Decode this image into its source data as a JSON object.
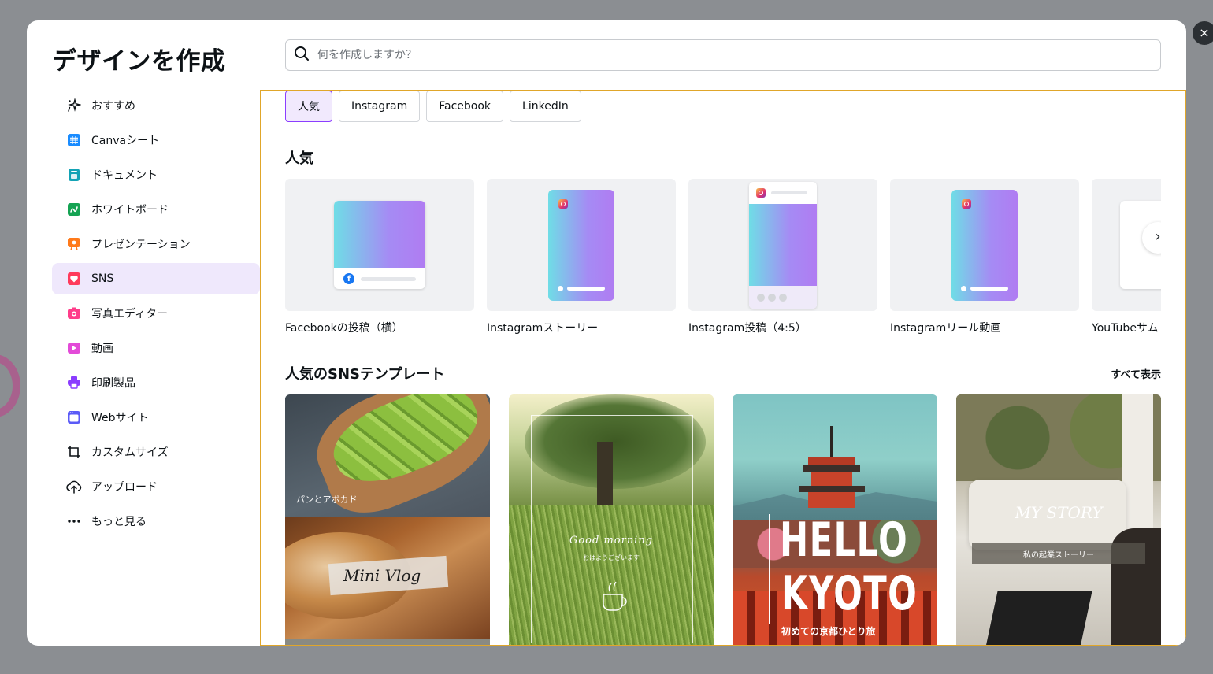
{
  "dialog": {
    "title": "デザインを作成",
    "search_placeholder": "何を作成しますか？",
    "close_label": "×"
  },
  "sidebar": {
    "items": [
      {
        "label": "おすすめ",
        "icon": "sparkle-icon",
        "color": "#0d1216"
      },
      {
        "label": "Canvaシート",
        "icon": "sheet-icon",
        "color": "#1a8cff"
      },
      {
        "label": "ドキュメント",
        "icon": "document-icon",
        "color": "#13a3b5"
      },
      {
        "label": "ホワイトボード",
        "icon": "whiteboard-icon",
        "color": "#15a353"
      },
      {
        "label": "プレゼンテーション",
        "icon": "presentation-icon",
        "color": "#ff7a1a"
      },
      {
        "label": "SNS",
        "icon": "heart-icon",
        "color": "#ff3b5c"
      },
      {
        "label": "写真エディター",
        "icon": "camera-icon",
        "color": "#ff3d8a"
      },
      {
        "label": "動画",
        "icon": "video-icon",
        "color": "#e34bd8"
      },
      {
        "label": "印刷製品",
        "icon": "printer-icon",
        "color": "#8b3dff"
      },
      {
        "label": "Webサイト",
        "icon": "website-icon",
        "color": "#5b5bf7"
      },
      {
        "label": "カスタムサイズ",
        "icon": "custom-size-icon",
        "color": "#0d1216"
      },
      {
        "label": "アップロード",
        "icon": "upload-icon",
        "color": "#0d1216"
      },
      {
        "label": "もっと見る",
        "icon": "more-icon",
        "color": "#0d1216"
      }
    ],
    "active_index": 5
  },
  "tabs": [
    "人気",
    "Instagram",
    "Facebook",
    "LinkedIn"
  ],
  "popular": {
    "title": "人気",
    "cards": [
      {
        "label": "Facebookの投稿（横）"
      },
      {
        "label": "Instagramストーリー"
      },
      {
        "label": "Instagram投稿（4:5）"
      },
      {
        "label": "Instagramリール動画"
      },
      {
        "label": "YouTubeサム"
      }
    ],
    "next_label": "›"
  },
  "templates": {
    "title": "人気のSNSテンプレート",
    "see_all": "すべて表示",
    "items": [
      {
        "caption_top": "パンとアボカド",
        "caption_mid": "Mini Vlog"
      },
      {
        "caption_top": "Good morning",
        "caption_sub": "おはようございます"
      },
      {
        "caption_top": "HELLO",
        "caption_mid": "KYOTO",
        "caption_sub": "初めての京都ひとり旅"
      },
      {
        "caption_top": "MY STORY",
        "caption_sub": "私の起業ストーリー"
      }
    ]
  },
  "colors": {
    "accent": "#8b3dff",
    "active_bg": "#efe8fc",
    "focus_border": "#e0a62a"
  }
}
